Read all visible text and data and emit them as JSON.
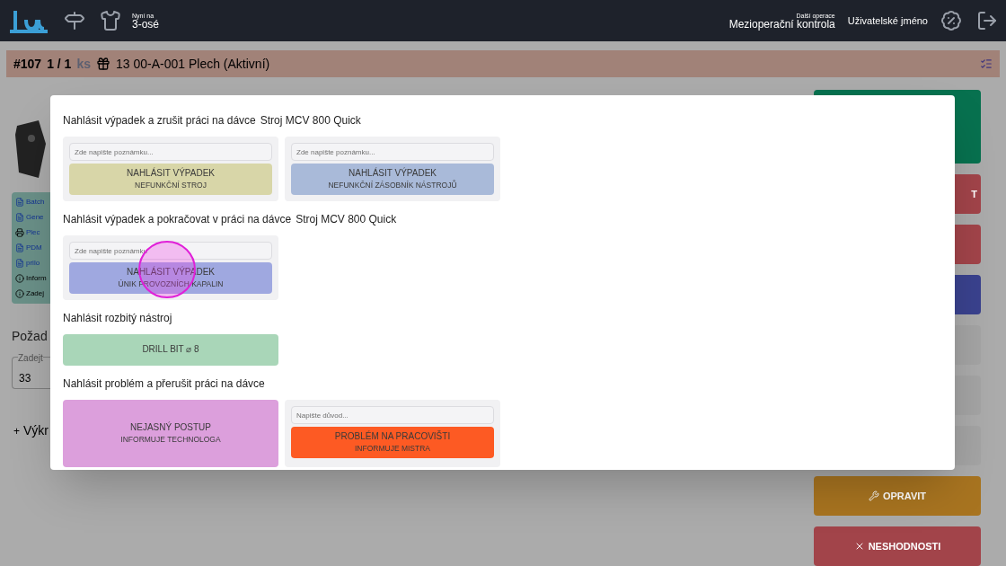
{
  "header": {
    "current": {
      "label": "Nyní na",
      "value": "3-osé"
    },
    "next_operation": {
      "label": "Další operace",
      "value": "Mezioperační kontrola"
    },
    "user": "Uživatelské jméno"
  },
  "job_bar": {
    "number": "#107",
    "count": "1 / 1",
    "unit": "ks",
    "item": "13 00-A-001 Plech (Aktivní)"
  },
  "documents": [
    {
      "kind": "pdf",
      "label": "Batch"
    },
    {
      "kind": "pdf",
      "label": "Gene"
    },
    {
      "kind": "print",
      "label": "Plec"
    },
    {
      "kind": "pdf",
      "label": "PDM"
    },
    {
      "kind": "pdf",
      "label": "prilo"
    },
    {
      "kind": "info",
      "label": "Inform"
    },
    {
      "kind": "info",
      "label": "Zadej"
    }
  ],
  "requirement": {
    "heading": "Požad",
    "field_label": "Zadejt",
    "value": "33"
  },
  "add_drawing": {
    "icon": "+",
    "label": "Výkr"
  },
  "side_buttons": [
    {
      "color": "#07714f"
    },
    {
      "color": "#a2444a",
      "label": "T"
    },
    {
      "color": "#a2444a"
    },
    {
      "color": "#3a428e"
    },
    {
      "color": "#a4a4a4"
    },
    {
      "color": "#a4a4a4"
    },
    {
      "color": "#a4a4a4"
    },
    {
      "kind": "wrench",
      "color": "#a87420",
      "label": "OPRAVIT"
    },
    {
      "kind": "close",
      "color": "#a2444a",
      "label": "NESHODNOSTI"
    }
  ],
  "modal": {
    "sections": [
      {
        "title": "Nahlásit výpadek a zrušit práci na dávce",
        "machine": "Stroj MCV 800 Quick",
        "options": [
          {
            "kind": "note",
            "placeholder": "Zde napište poznámku...",
            "title": "NAHLÁSIT VÝPADEK",
            "subtitle": "NEFUNKČNÍ STROJ",
            "color": "#d8d6a8"
          },
          {
            "kind": "note",
            "placeholder": "Zde napište poznámku...",
            "title": "NAHLÁSIT VÝPADEK",
            "subtitle": "NEFUNKČNÍ ZÁSOBNÍK NÁSTROJŮ",
            "color": "#a9bad9"
          }
        ]
      },
      {
        "title": "Nahlásit výpadek a pokračovat v práci na dávce",
        "machine": "Stroj MCV 800 Quick",
        "options": [
          {
            "kind": "note",
            "placeholder": "Zde napište poznámku",
            "title": "NAHLÁSIT VÝPADEK",
            "subtitle": "ÚNIK PROVOZNÍCH KAPALIN",
            "color": "#9fa8e0"
          }
        ]
      },
      {
        "title": "Nahlásit rozbitý nástroj",
        "options": [
          {
            "kind": "plain",
            "title": "DRILL BIT ⌀ 8",
            "color": "#a9d6b8"
          }
        ]
      },
      {
        "title": "Nahlásit problém a přerušit práci na dávce",
        "options": [
          {
            "kind": "large",
            "title": "NEJASNÝ POSTUP",
            "subtitle": "INFORMUJE TECHNOLOGA",
            "color": "#dc9fdc"
          },
          {
            "kind": "note",
            "placeholder": "Napište důvod...",
            "title": "PROBLÉM NA PRACOVIŠTI",
            "subtitle": "INFORMUJE MISTRA",
            "color": "#fd5a23"
          }
        ]
      }
    ]
  }
}
